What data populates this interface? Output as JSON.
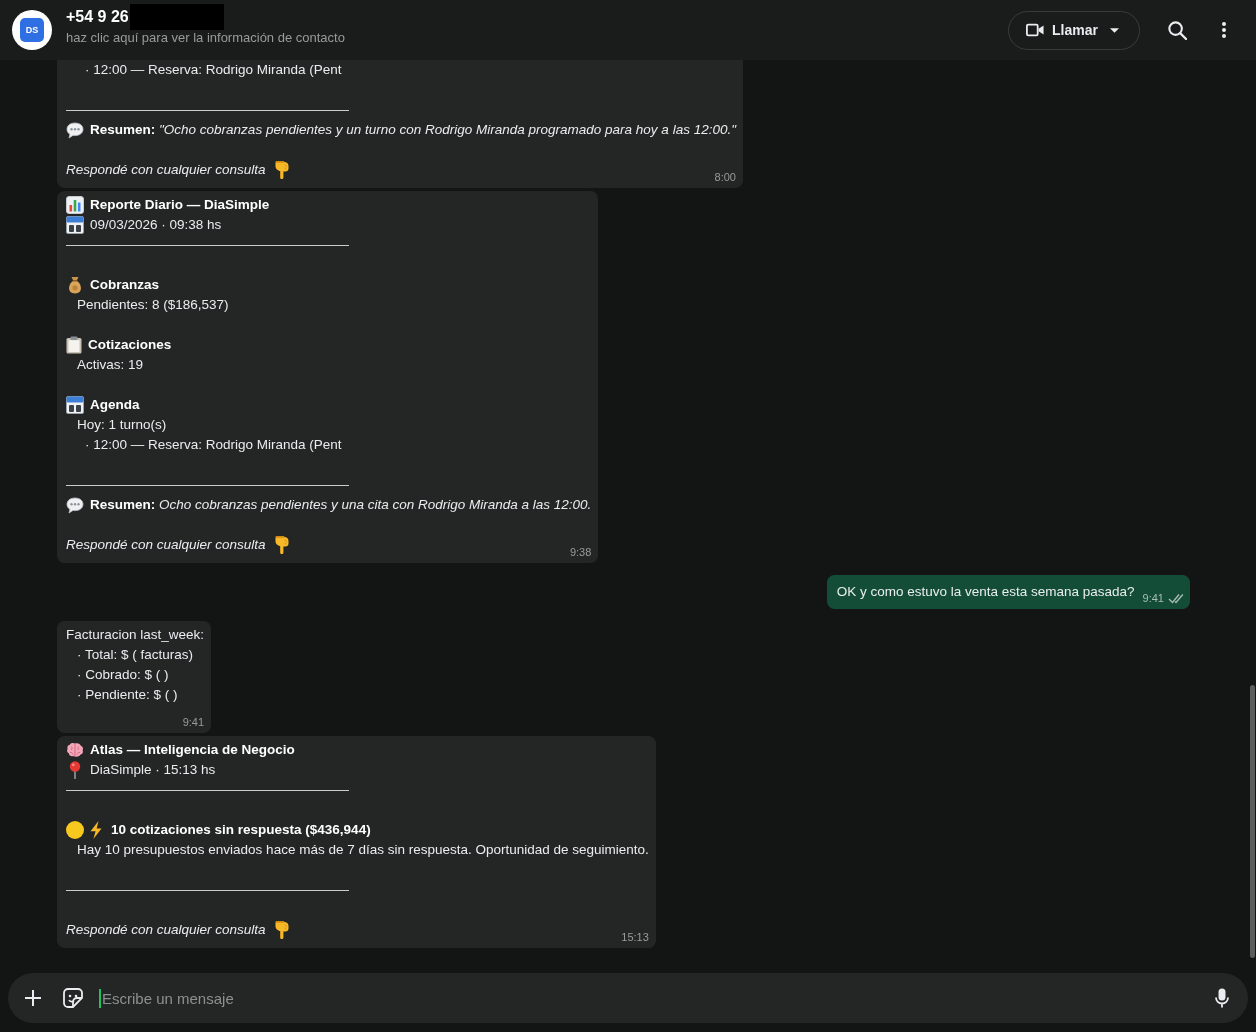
{
  "header": {
    "avatar_initials": "DS",
    "title": "+54 9 26",
    "redacted": true,
    "subtitle": "haz clic aquí para ver la información de contacto",
    "call_button": "Llamar"
  },
  "messages": [
    {
      "outgoing": false,
      "time": "8:00",
      "lines": [
        {
          "kind": "subitem",
          "text": "· 12:00 — Reserva: Rodrigo Miranda (Pent"
        },
        {
          "kind": "blank"
        },
        {
          "kind": "rule"
        },
        {
          "kind": "summary",
          "text": "**Resumen:** *\"Ocho cobranzas pendientes y un turno con Rodrigo Miranda programado para hoy a las 12:00.\"*"
        },
        {
          "kind": "blank"
        },
        {
          "kind": "closing",
          "text": "Respondé con cualquier consulta"
        }
      ]
    },
    {
      "outgoing": false,
      "time": "9:38",
      "lines": [
        {
          "kind": "heading",
          "text": "Reporte Diario — DiaSimple"
        },
        {
          "kind": "text",
          "text": "09/03/2026 · 09:38 hs"
        },
        {
          "kind": "rule"
        },
        {
          "kind": "blank"
        },
        {
          "kind": "heading",
          "text": "Cobranzas"
        },
        {
          "kind": "item",
          "text": "Pendientes: 8 ($186,537)"
        },
        {
          "kind": "blank"
        },
        {
          "kind": "heading",
          "text": "Cotizaciones"
        },
        {
          "kind": "item",
          "text": "Activas: 19"
        },
        {
          "kind": "blank"
        },
        {
          "kind": "heading",
          "text": "Agenda"
        },
        {
          "kind": "item",
          "text": "Hoy: 1 turno(s)"
        },
        {
          "kind": "subitem",
          "text": "· 12:00 — Reserva: Rodrigo Miranda (Pent"
        },
        {
          "kind": "blank"
        },
        {
          "kind": "rule"
        },
        {
          "kind": "summary",
          "text": "**Resumen:** *Ocho cobranzas pendientes y una cita con Rodrigo Miranda a las 12:00.*"
        },
        {
          "kind": "blank"
        },
        {
          "kind": "closing",
          "text": "Respondé con cualquier consulta"
        }
      ]
    },
    {
      "outgoing": true,
      "time": "9:41",
      "read": false,
      "lines": [
        {
          "kind": "text",
          "text": "OK y como estuvo la venta esta semana pasada?"
        }
      ]
    },
    {
      "outgoing": false,
      "time": "9:41",
      "lines": [
        {
          "kind": "text",
          "text": "Facturacion last_week:"
        },
        {
          "kind": "item",
          "text": "· Total: $ ( facturas)"
        },
        {
          "kind": "item",
          "text": "· Cobrado: $ ( )"
        },
        {
          "kind": "item",
          "text": "· Pendiente: $ ( )"
        },
        {
          "kind": "blank"
        }
      ]
    },
    {
      "outgoing": false,
      "time": "15:13",
      "lines": [
        {
          "kind": "heading",
          "text": "Atlas — Inteligencia de Negocio"
        },
        {
          "kind": "text",
          "text": "DiaSimple · 15:13 hs"
        },
        {
          "kind": "rule"
        },
        {
          "kind": "blank"
        },
        {
          "kind": "heading",
          "text": "10 cotizaciones sin respuesta ($436,944)"
        },
        {
          "kind": "item",
          "text": "Hay 10 presupuestos enviados hace más de 7 días sin respuesta. Oportunidad de seguimiento."
        },
        {
          "kind": "blank"
        },
        {
          "kind": "rule"
        },
        {
          "kind": "blank"
        },
        {
          "kind": "closing",
          "text": "Respondé con cualquier consulta"
        }
      ]
    }
  ],
  "composer": {
    "placeholder": "Escribe un mensaje"
  }
}
